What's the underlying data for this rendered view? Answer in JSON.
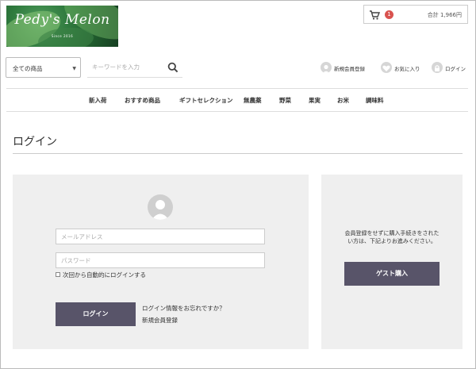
{
  "header": {
    "logo_text": "Pedy's Melon",
    "logo_sub": "Since 2016",
    "cart": {
      "badge": "1",
      "total": "合計 1,966円",
      "icon": "cart-icon"
    }
  },
  "search": {
    "category": "全ての商品",
    "placeholder": "キーワードを入力",
    "icon": "search-icon"
  },
  "user_links": [
    {
      "label": "新規会員登録",
      "icon": "user-icon"
    },
    {
      "label": "お気に入り",
      "icon": "heart-icon"
    },
    {
      "label": "ログイン",
      "icon": "lock-icon"
    }
  ],
  "nav": [
    "新入荷",
    "おすすめ商品",
    "ギフトセレクション",
    "無農薬",
    "野菜",
    "果実",
    "お米",
    "調味料"
  ],
  "page_title": "ログイン",
  "login_form": {
    "email_placeholder": "メールアドレス",
    "password_placeholder": "パスワード",
    "remember_label": "次回から自動的にログインする",
    "login_button": "ログイン",
    "forgot_link": "ログイン情報をお忘れですか？",
    "register_link": "新規会員登録"
  },
  "guest": {
    "text": "会員登録をせずに購入手続きをされたい方は、下記よりお進みください。",
    "button": "ゲスト購入"
  },
  "colors": {
    "button": "#585469",
    "panel": "#efefef",
    "badge": "#d9534f"
  }
}
